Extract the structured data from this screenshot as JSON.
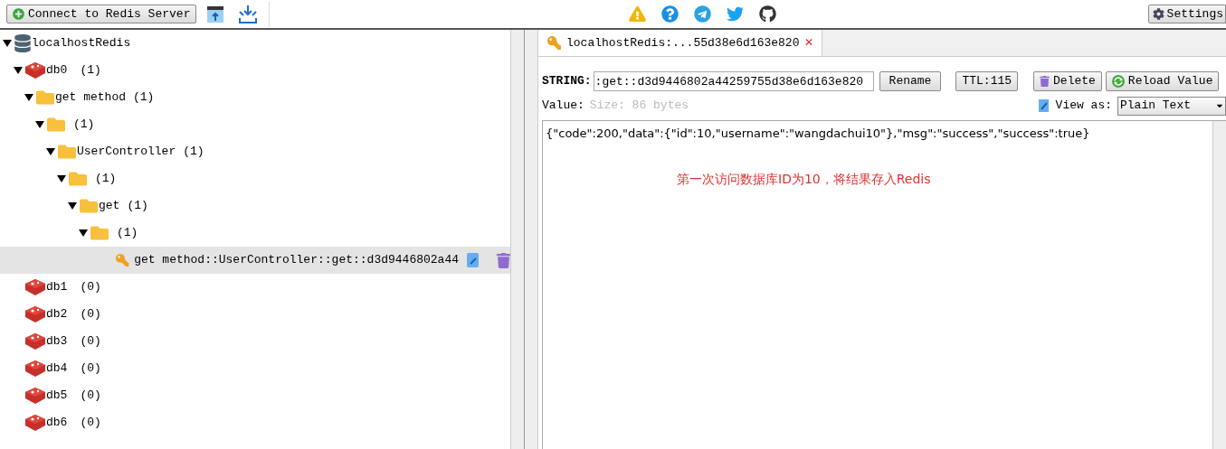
{
  "toolbar": {
    "connect_button": "Connect to Redis Server",
    "settings_button": "Settings"
  },
  "tree": [
    {
      "kind": "server",
      "label": "localhostRedis",
      "expanded": true,
      "selected": false,
      "children": [
        {
          "kind": "db",
          "label": "db0",
          "count": "(1)",
          "expanded": true,
          "selected": false,
          "children": [
            {
              "kind": "folder",
              "label": "get method",
              "count": "(1)",
              "expanded": true,
              "selected": false,
              "children": [
                {
                  "kind": "folder",
                  "count": "(1)",
                  "expanded": true,
                  "selected": false,
                  "children": [
                    {
                      "kind": "folder",
                      "label": "UserController",
                      "count": "(1)",
                      "expanded": true,
                      "selected": false,
                      "children": [
                        {
                          "kind": "folder",
                          "count": "(1)",
                          "expanded": true,
                          "selected": false,
                          "children": [
                            {
                              "kind": "folder",
                              "label": "get",
                              "count": "(1)",
                              "expanded": true,
                              "selected": false,
                              "children": [
                                {
                                  "kind": "folder",
                                  "count": "(1)",
                                  "expanded": true,
                                  "selected": false,
                                  "children": [
                                    {
                                      "kind": "key",
                                      "label": "get method::UserController::get::d3d9446802a44",
                                      "selected": true
                                    }
                                  ]
                                }
                              ]
                            }
                          ]
                        }
                      ]
                    }
                  ]
                }
              ]
            }
          ]
        },
        {
          "kind": "db",
          "label": "db1",
          "count": "(0)",
          "selected": false
        },
        {
          "kind": "db",
          "label": "db2",
          "count": "(0)",
          "selected": false
        },
        {
          "kind": "db",
          "label": "db3",
          "count": "(0)",
          "selected": false
        },
        {
          "kind": "db",
          "label": "db4",
          "count": "(0)",
          "selected": false
        },
        {
          "kind": "db",
          "label": "db5",
          "count": "(0)",
          "selected": false
        },
        {
          "kind": "db",
          "label": "db6",
          "count": "(0)",
          "selected": false
        }
      ]
    }
  ],
  "editor": {
    "tab": {
      "label": "localhostRedis:...55d38e6d163e820",
      "close": "✕"
    },
    "type_label": "STRING:",
    "key_value": ":get::d3d9446802a44259755d38e6d163e820",
    "buttons": [
      {
        "kind": "plain",
        "label": "Rename"
      },
      {
        "kind": "plain",
        "label": "TTL:115"
      },
      {
        "kind": "delete",
        "label": "Delete"
      },
      {
        "kind": "reload",
        "label": "Reload Value"
      }
    ],
    "value_label": "Value:",
    "size": "Size: 86 bytes",
    "view_as_label": "View as:",
    "view_as_value": "Plain Text",
    "value": "{\"code\":200,\"data\":{\"id\":10,\"username\":\"wangdachui10\"},\"msg\":\"success\",\"success\":true}",
    "annotation": "第一次访问数据库ID为10，将结果存入Redis"
  }
}
